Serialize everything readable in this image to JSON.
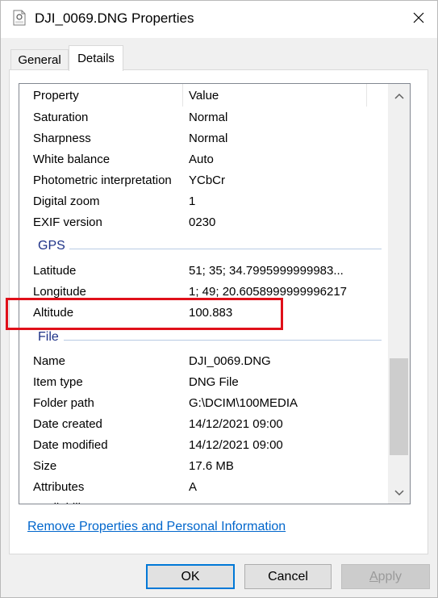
{
  "window": {
    "title": "DJI_0069.DNG Properties",
    "title_icon": "dng-file-icon",
    "close_icon": "close-icon"
  },
  "tabs": [
    {
      "label": "General",
      "selected": false
    },
    {
      "label": "Details",
      "selected": true
    }
  ],
  "list": {
    "columns": {
      "property": "Property",
      "value": "Value"
    },
    "rows_top": [
      {
        "name": "Saturation",
        "value": "Normal"
      },
      {
        "name": "Sharpness",
        "value": "Normal"
      },
      {
        "name": "White balance",
        "value": "Auto"
      },
      {
        "name": "Photometric interpretation",
        "value": "YCbCr"
      },
      {
        "name": "Digital zoom",
        "value": "1"
      },
      {
        "name": "EXIF version",
        "value": "0230"
      }
    ],
    "group_gps": "GPS",
    "rows_gps": [
      {
        "name": "Latitude",
        "value": "51; 35; 34.7995999999983..."
      },
      {
        "name": "Longitude",
        "value": "1; 49; 20.6058999999996217"
      },
      {
        "name": "Altitude",
        "value": "100.883"
      }
    ],
    "group_file": "File",
    "rows_file": [
      {
        "name": "Name",
        "value": "DJI_0069.DNG"
      },
      {
        "name": "Item type",
        "value": "DNG File"
      },
      {
        "name": "Folder path",
        "value": "G:\\DCIM\\100MEDIA"
      },
      {
        "name": "Date created",
        "value": "14/12/2021 09:00"
      },
      {
        "name": "Date modified",
        "value": "14/12/2021 09:00"
      },
      {
        "name": "Size",
        "value": "17.6 MB"
      },
      {
        "name": "Attributes",
        "value": "A"
      },
      {
        "name": "Availability",
        "value": ""
      }
    ],
    "highlight_color": "#e0101a"
  },
  "links": {
    "remove_properties": "Remove Properties and Personal Information"
  },
  "buttons": {
    "ok": "OK",
    "cancel": "Cancel",
    "apply_accel": "A",
    "apply_rest": "pply"
  },
  "colors": {
    "accent": "#0078d7",
    "link": "#0066cc",
    "group_label": "#1e3287"
  }
}
